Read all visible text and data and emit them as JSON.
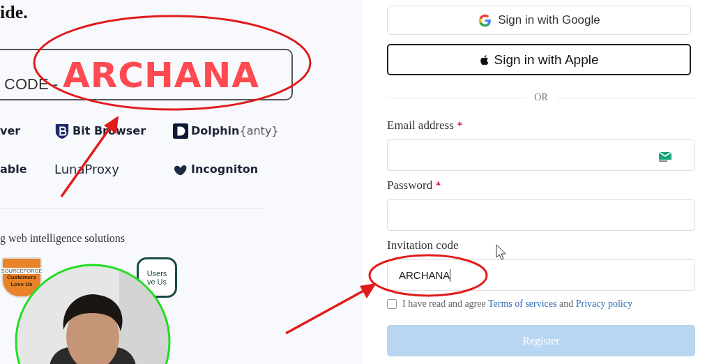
{
  "left": {
    "heading_fragment": "ide.",
    "promo": {
      "code_label": "CODE -"
    },
    "partner_logos": [
      {
        "kind": "plain",
        "name": "ver"
      },
      {
        "kind": "bit",
        "name": "Bit Browser"
      },
      {
        "kind": "dolphin",
        "name": "Dolphin",
        "suffix": "{anty}"
      },
      {
        "kind": "plain",
        "name": "able"
      },
      {
        "kind": "luna",
        "name": "LunaProxy"
      },
      {
        "kind": "incogniton",
        "name": "Incogniton"
      }
    ],
    "tagline": "g web intelligence solutions",
    "badges": [
      {
        "kind": "shield",
        "lines": [
          "SOURCEFORGE",
          "Customers",
          "Love Us"
        ]
      },
      {
        "kind": "hexagon",
        "lines": [
          "Users",
          "ve Us"
        ]
      }
    ]
  },
  "overlay": {
    "callout": "ARCHANA"
  },
  "signin": {
    "social_buttons": [
      {
        "kind": "google",
        "label": "Sign in with Google"
      },
      {
        "kind": "apple",
        "label": "Sign in with Apple"
      }
    ],
    "separator": "OR",
    "fields": [
      {
        "kind": "email",
        "label": "Email address",
        "required": true
      },
      {
        "kind": "password",
        "label": "Password",
        "required": true
      },
      {
        "kind": "text",
        "label": "Invitation code",
        "required": false,
        "value": "ARCHANA"
      }
    ],
    "agreement": {
      "checked": false,
      "before": "I have read and agree",
      "terms_link": "Terms of services",
      "middle": "and",
      "privacy_link": "Privacy policy"
    },
    "register_button": {
      "label": "Register",
      "disabled": true
    }
  }
}
